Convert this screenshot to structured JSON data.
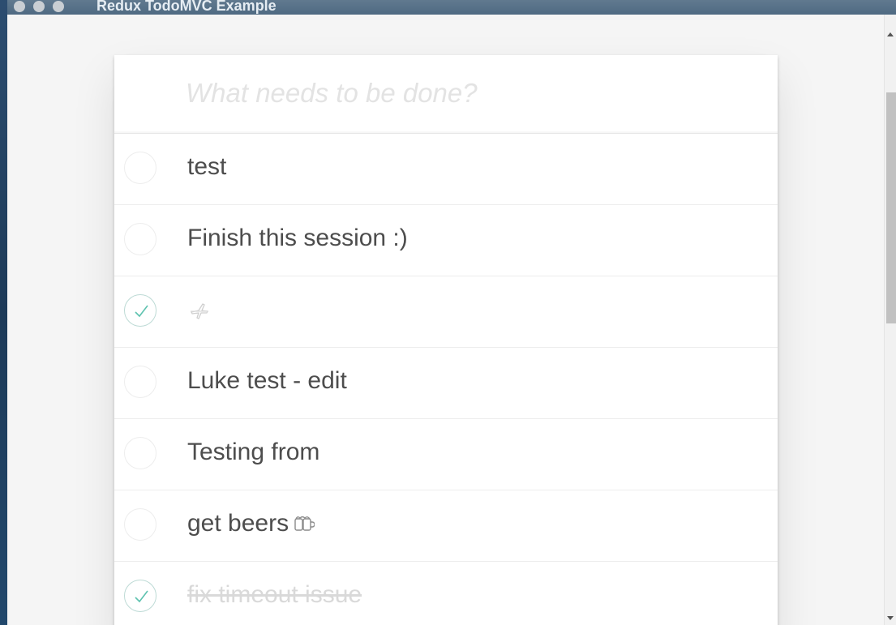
{
  "window": {
    "title": "Redux TodoMVC Example"
  },
  "new_todo": {
    "placeholder": "What needs to be done?",
    "value": ""
  },
  "todos": [
    {
      "label": "test",
      "completed": false
    },
    {
      "label": "Finish this session :)",
      "completed": false
    },
    {
      "label": "",
      "icon": "airplane-emoji-icon",
      "completed": true
    },
    {
      "label": "Luke test - edit",
      "completed": false
    },
    {
      "label": "Testing from",
      "completed": false
    },
    {
      "label": "get beers",
      "icon": "beer-emoji-icon",
      "completed": false
    },
    {
      "label": "fix timeout issue",
      "completed": true
    }
  ],
  "colors": {
    "check": "#5dc2af",
    "completed_text": "#d9d9d9",
    "text": "#4d4d4d",
    "placeholder": "#e3e3e3"
  }
}
